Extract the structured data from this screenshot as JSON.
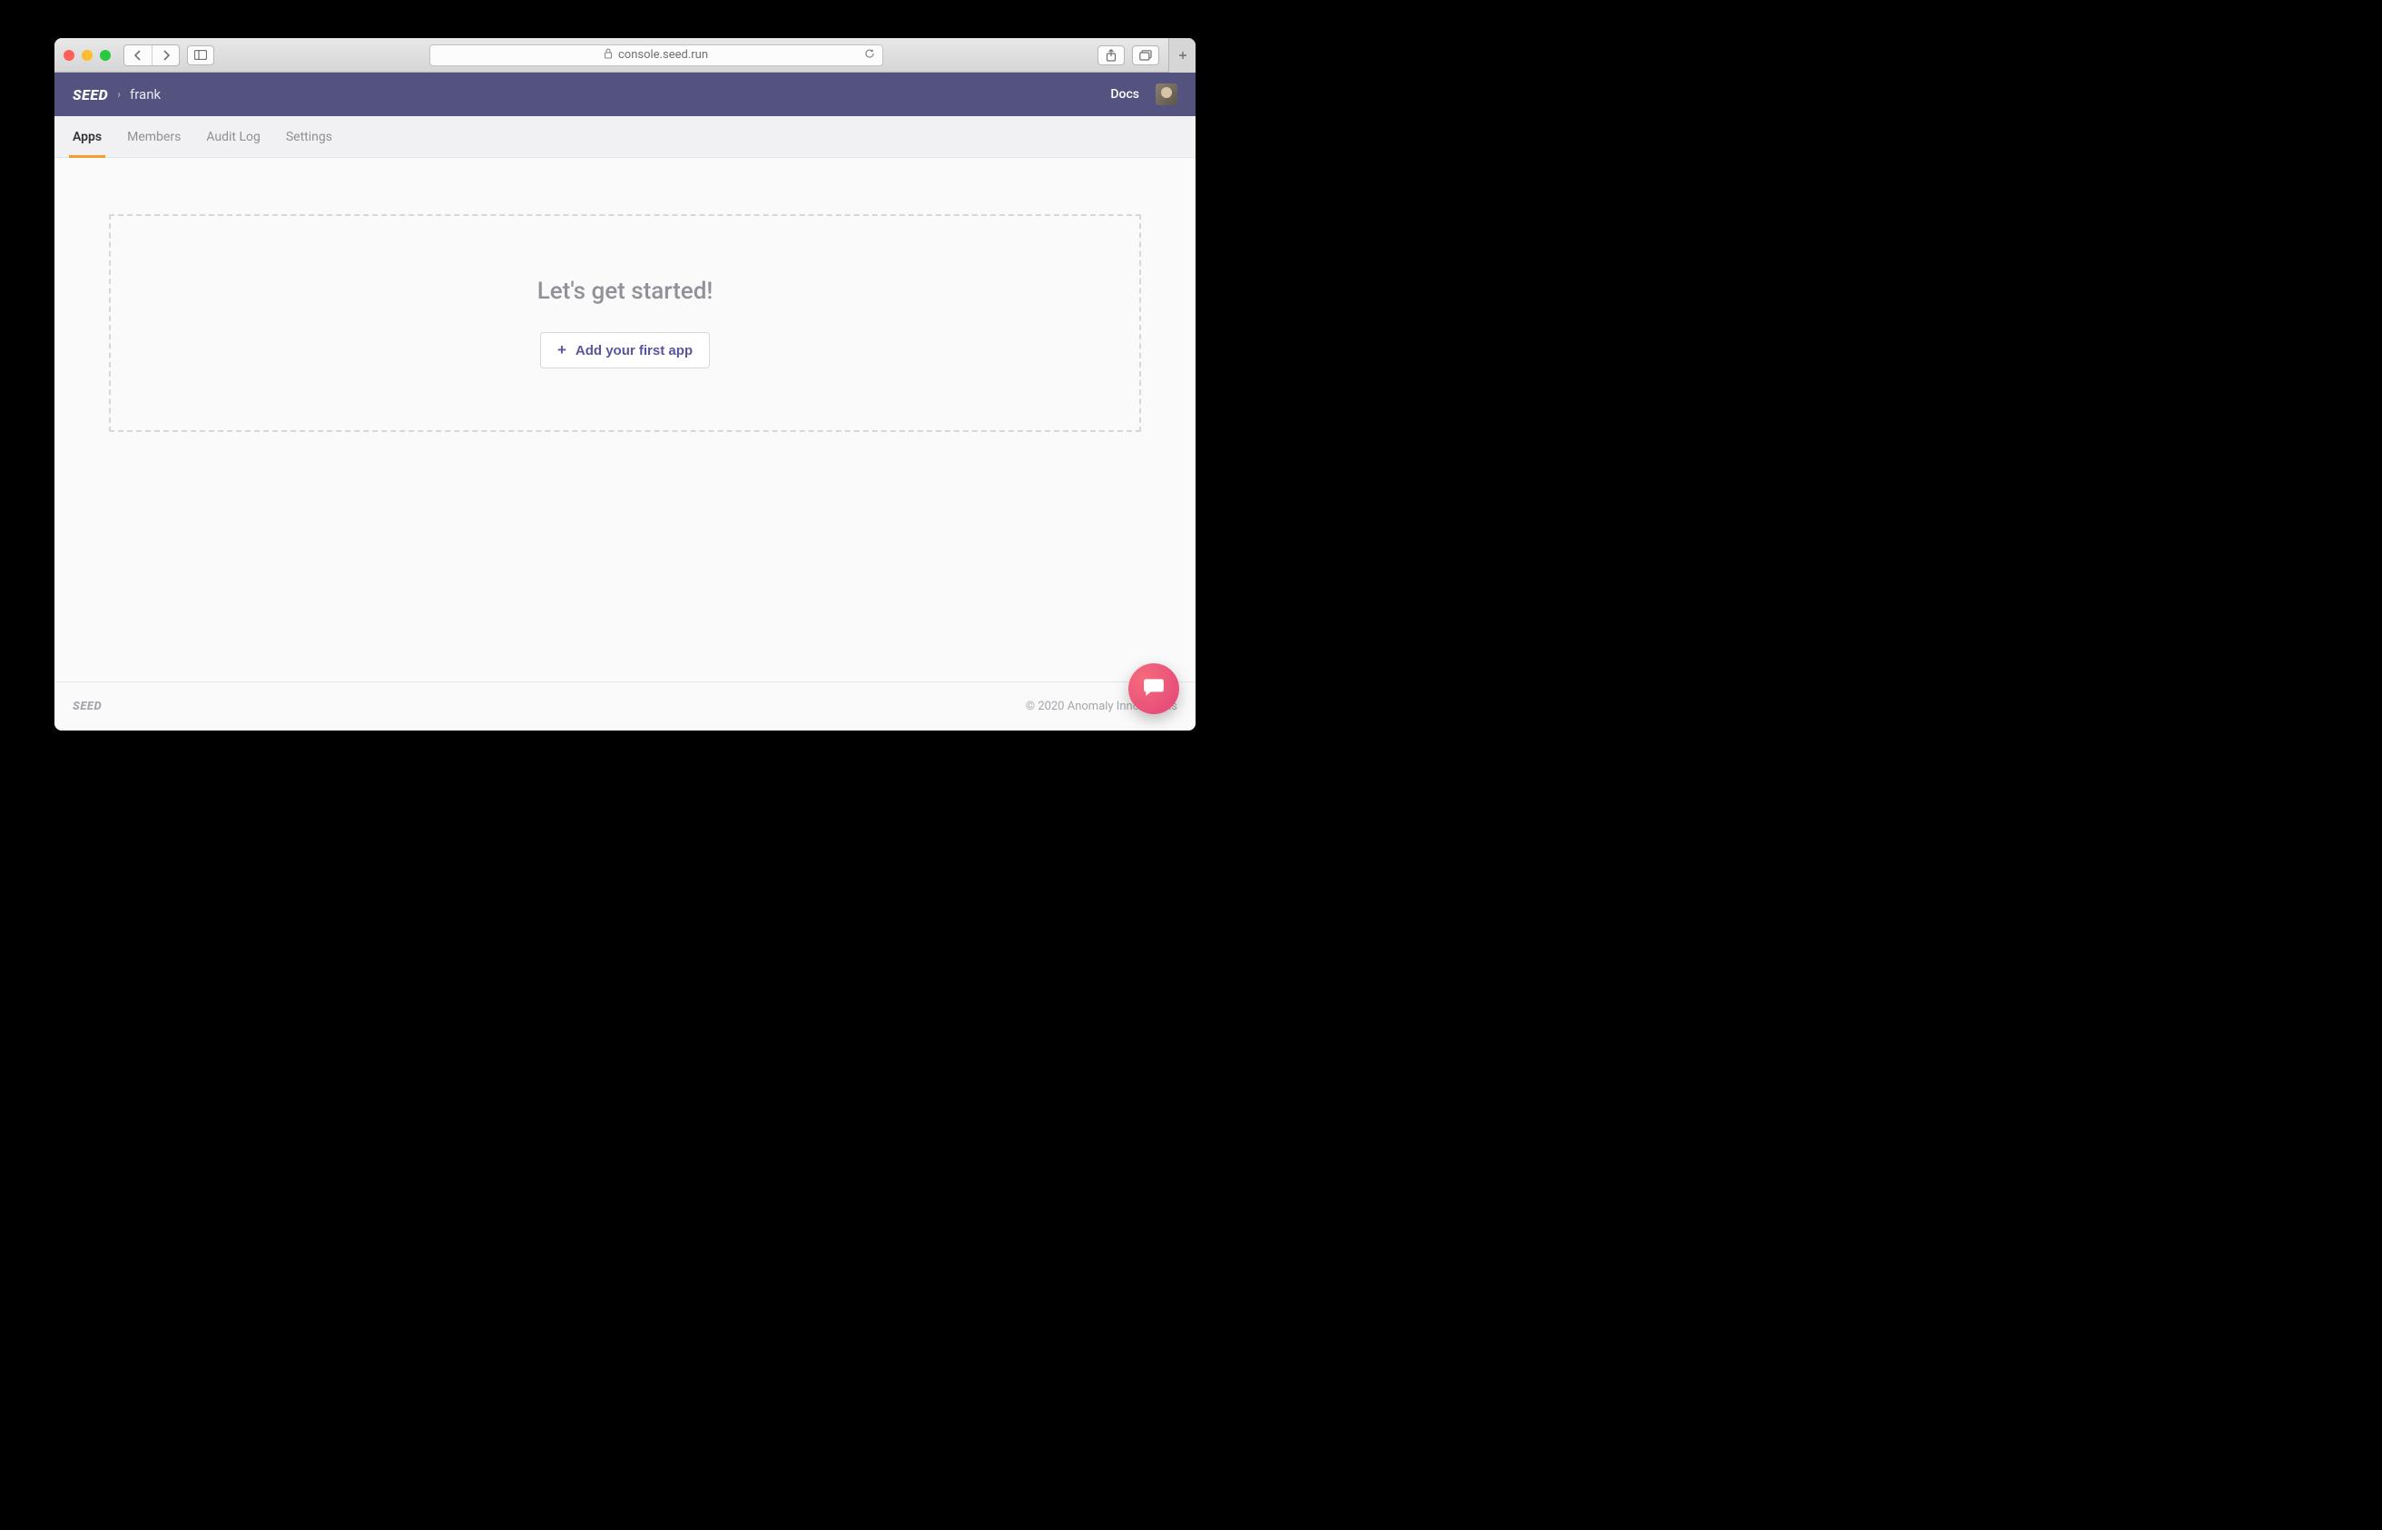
{
  "browser": {
    "url": "console.seed.run"
  },
  "header": {
    "brand": "SEED",
    "breadcrumb_sep": "›",
    "breadcrumb": "frank",
    "docs_label": "Docs"
  },
  "tabs": [
    {
      "label": "Apps",
      "active": true
    },
    {
      "label": "Members",
      "active": false
    },
    {
      "label": "Audit Log",
      "active": false
    },
    {
      "label": "Settings",
      "active": false
    }
  ],
  "empty_state": {
    "title": "Let's get started!",
    "button_label": "Add your first app"
  },
  "footer": {
    "brand": "SEED",
    "copyright": "© 2020 Anomaly Innovations"
  }
}
